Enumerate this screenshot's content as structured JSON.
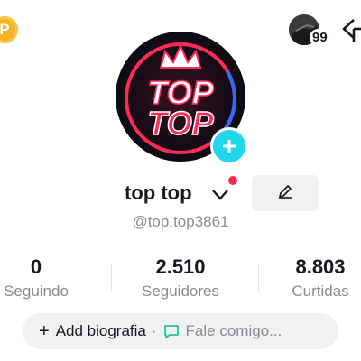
{
  "header": {
    "coin_glyph": "P",
    "notification_count": "99"
  },
  "profile": {
    "avatar_text_line1": "TOP",
    "avatar_text_line2": "TOP",
    "add_glyph": "+",
    "display_name": "top top",
    "username": "@top.top3861"
  },
  "stats": [
    {
      "value": "0",
      "label": "Seguindo"
    },
    {
      "value": "2.510",
      "label": "Seguidores"
    },
    {
      "value": "8.803",
      "label": "Curtidas"
    }
  ],
  "bio": {
    "plus_glyph": "+",
    "add_label": "Add biografia",
    "separator": "·",
    "message_label": "Fale comigo..."
  },
  "colors": {
    "accent_cyan": "#20d5ec",
    "notification_red": "#fe2c55",
    "coin_gold": "#f5b323",
    "muted_text": "#8a8b91"
  }
}
